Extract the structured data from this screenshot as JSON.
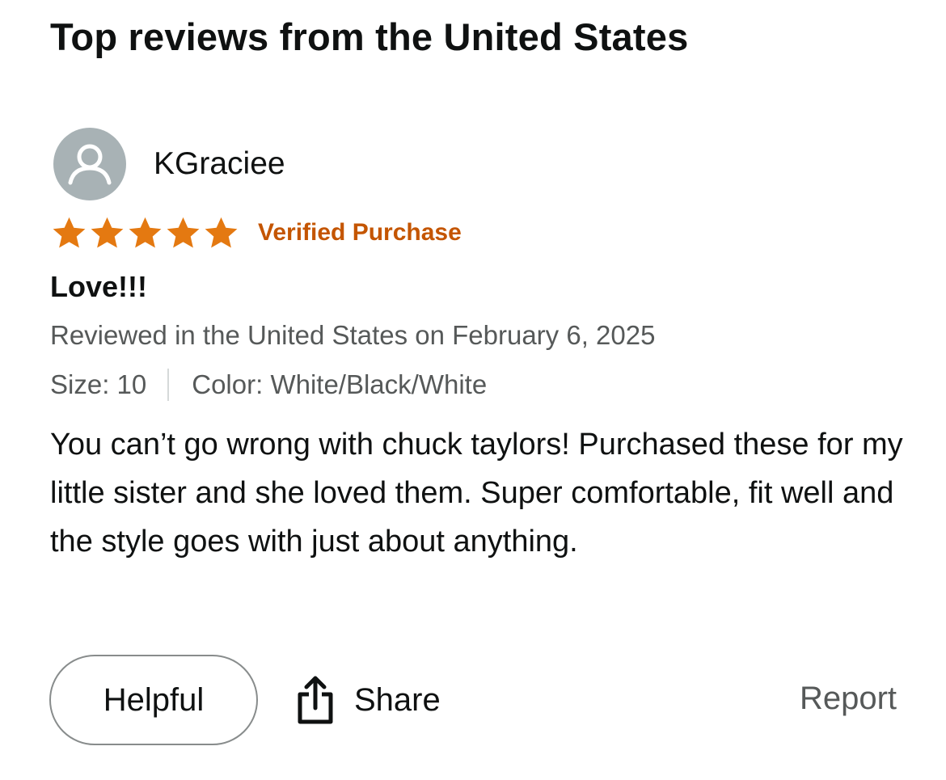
{
  "section": {
    "title": "Top reviews from the United States"
  },
  "review": {
    "profile": {
      "name": "KGraciee",
      "avatar_icon": "person-silhouette-icon",
      "avatar_color": "#a8b2b5"
    },
    "rating": {
      "stars": 5,
      "max_stars": 5,
      "star_color": "#e47911"
    },
    "verified_label": "Verified Purchase",
    "verified_color": "#c45500",
    "title": "Love!!!",
    "date_line": "Reviewed in the United States on February 6, 2025",
    "variants": {
      "size": "Size: 10",
      "color": "Color: White/Black/White"
    },
    "body": "You can’t go wrong with chuck taylors! Purchased these for my little sister and she loved them. Super comfortable, fit well and the style goes with just about anything."
  },
  "actions": {
    "helpful_label": "Helpful",
    "share_label": "Share",
    "share_icon": "share-upload-icon",
    "report_label": "Report"
  }
}
